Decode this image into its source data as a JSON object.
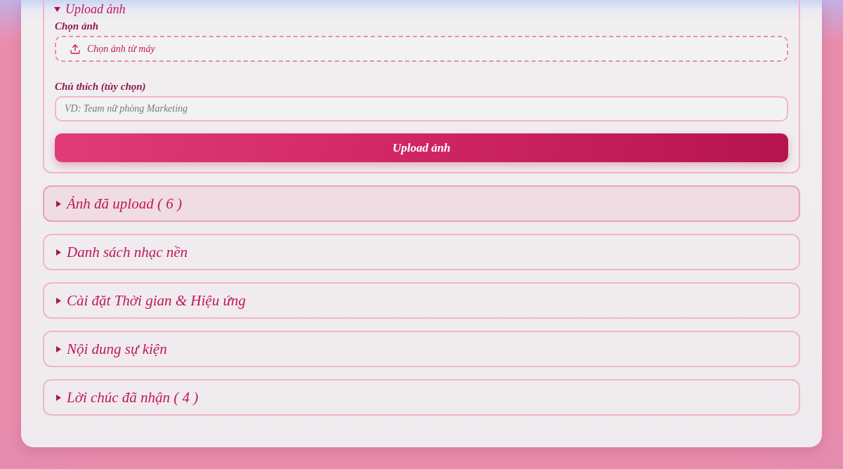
{
  "sections": [
    {
      "title": "Upload ảnh",
      "expanded": true,
      "highlighted": false,
      "fields": [
        {
          "kind": "file",
          "label": "Chọn ảnh",
          "button": "Chọn ảnh từ máy"
        },
        {
          "kind": "text",
          "label": "Chú thích (tùy chọn)",
          "placeholder": "VD: Team nữ phòng Marketing"
        }
      ],
      "submit": "Upload ảnh"
    },
    {
      "title": "Ảnh đã upload ( 6 )",
      "expanded": false,
      "highlighted": true
    },
    {
      "title": "Danh sách nhạc nền",
      "expanded": false,
      "highlighted": false
    },
    {
      "title": "Cài đặt Thời gian & Hiệu ứng",
      "expanded": false,
      "highlighted": false
    },
    {
      "title": "Nội dung sự kiện",
      "expanded": false,
      "highlighted": false
    },
    {
      "title": "Lời chúc đã nhận ( 4 )",
      "expanded": false,
      "highlighted": false
    }
  ]
}
